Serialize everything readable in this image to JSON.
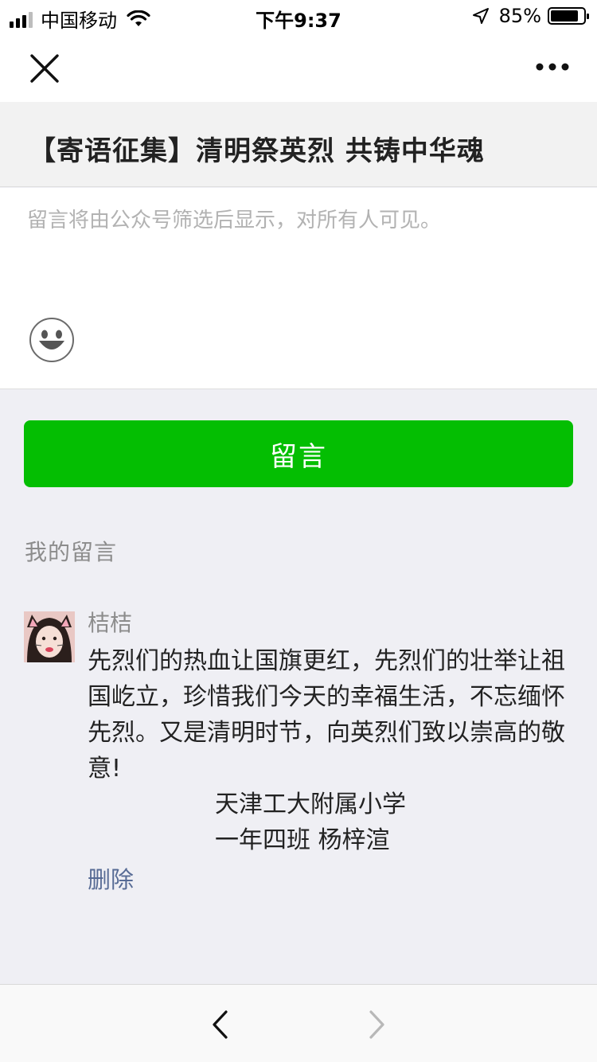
{
  "status_bar": {
    "carrier": "中国移动",
    "time": "下午9:37",
    "battery_percent_label": "85%",
    "battery_level": 0.85
  },
  "navbar": {
    "close_icon": "close-icon",
    "more_icon": "more-dots-icon"
  },
  "article": {
    "title": "【寄语征集】清明祭英烈 共铸中华魂"
  },
  "comment_input": {
    "placeholder": "留言将由公众号筛选后显示，对所有人可见。",
    "value": ""
  },
  "submit": {
    "label": "留言"
  },
  "my_comments": {
    "label": "我的留言",
    "items": [
      {
        "nickname": "桔桔",
        "content": "先烈们的热血让国旗更红，先烈们的壮举让祖国屹立，珍惜我们今天的幸福生活，不忘缅怀先烈。又是清明时节，向英烈们致以崇高的敬意!",
        "signature_line1": "天津工大附属小学",
        "signature_line2": "一年四班 杨梓渲",
        "delete_label": "删除"
      }
    ]
  },
  "toolbar": {
    "back_icon": "chevron-left-icon",
    "forward_icon": "chevron-right-icon"
  },
  "colors": {
    "accent_green": "#04be02",
    "link_blue": "#576b95",
    "page_bg": "#efeff4"
  }
}
